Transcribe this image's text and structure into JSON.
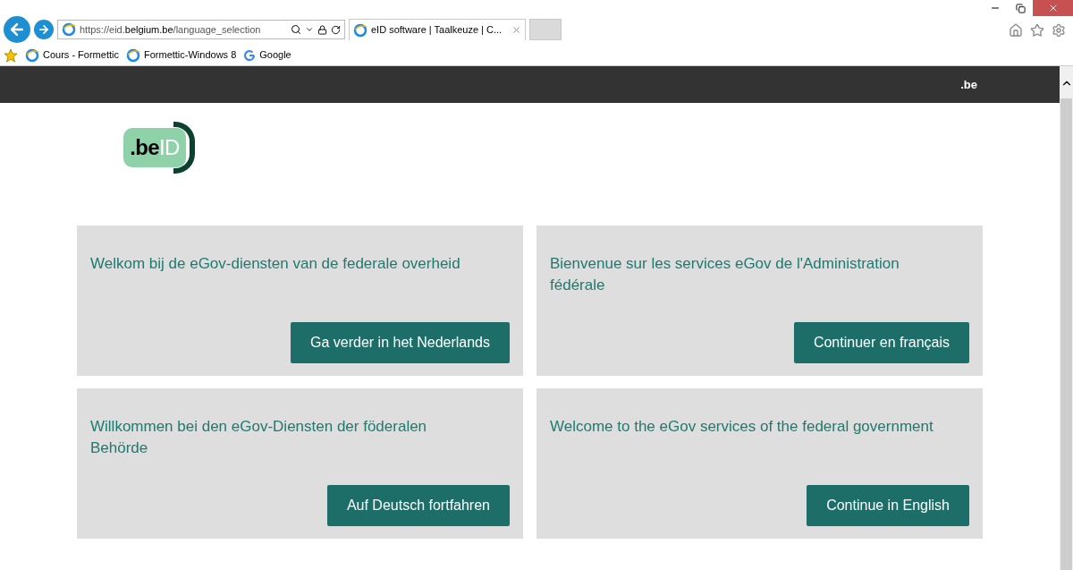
{
  "browser": {
    "address": {
      "prefix": "https://eid.",
      "domain": "belgium.be",
      "path": "/language_selection"
    },
    "tab": {
      "title": "eID software | Taalkeuze | C...",
      "selected": true
    },
    "favorites": [
      {
        "label": "Cours - Formettic",
        "kind": "ie"
      },
      {
        "label": "Formettic-Windows 8",
        "kind": "ie"
      },
      {
        "label": "Google",
        "kind": "google"
      }
    ]
  },
  "header": {
    "brand": ".be"
  },
  "logo": {
    "be": ".be",
    "id": "ID"
  },
  "cards": [
    {
      "title": "Welkom bij de eGov-diensten van de federale overheid",
      "button": "Ga verder in het Nederlands"
    },
    {
      "title": "Bienvenue sur les services eGov de l'Administration fédérale",
      "button": "Continuer en français"
    },
    {
      "title": "Willkommen bei den eGov-Diensten der föderalen Behörde",
      "button": "Auf Deutsch fortfahren"
    },
    {
      "title": "Welcome to the eGov services of the federal government",
      "button": "Continue in English"
    }
  ]
}
